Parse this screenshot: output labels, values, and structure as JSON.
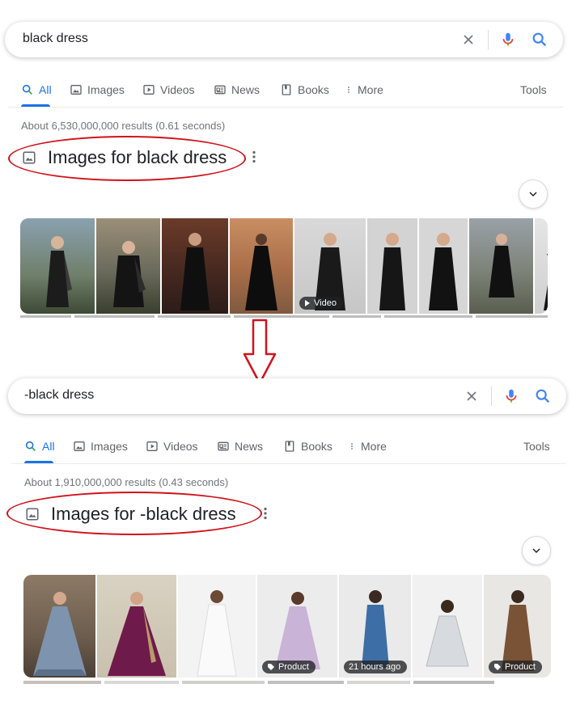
{
  "colors": {
    "accent": "#1a73e8",
    "annotation": "#d0121b",
    "muted": "#70757a"
  },
  "tabs": [
    {
      "label": "All",
      "icon": "search-icon"
    },
    {
      "label": "Images",
      "icon": "image-icon"
    },
    {
      "label": "Videos",
      "icon": "play-icon"
    },
    {
      "label": "News",
      "icon": "newspaper-icon"
    },
    {
      "label": "Books",
      "icon": "book-icon"
    },
    {
      "label": "More",
      "icon": "more-vert-icon"
    }
  ],
  "tools_label": "Tools",
  "top": {
    "query": "black dress",
    "stats": "About 6,530,000,000 results (0.61 seconds)",
    "images_heading": "Images for black dress",
    "thumbs": [
      {
        "badge": ""
      },
      {
        "badge": ""
      },
      {
        "badge": ""
      },
      {
        "badge": ""
      },
      {
        "badge": "Video"
      },
      {
        "badge": ""
      },
      {
        "badge": ""
      },
      {
        "badge": ""
      }
    ]
  },
  "bottom": {
    "query": "-black dress",
    "stats": "About 1,910,000,000 results (0.43 seconds)",
    "images_heading": "Images for -black dress",
    "thumbs": [
      {
        "badge": ""
      },
      {
        "badge": ""
      },
      {
        "badge": ""
      },
      {
        "badge": "Product"
      },
      {
        "badge": "21 hours ago"
      },
      {
        "badge": ""
      },
      {
        "badge": "Product"
      }
    ]
  }
}
